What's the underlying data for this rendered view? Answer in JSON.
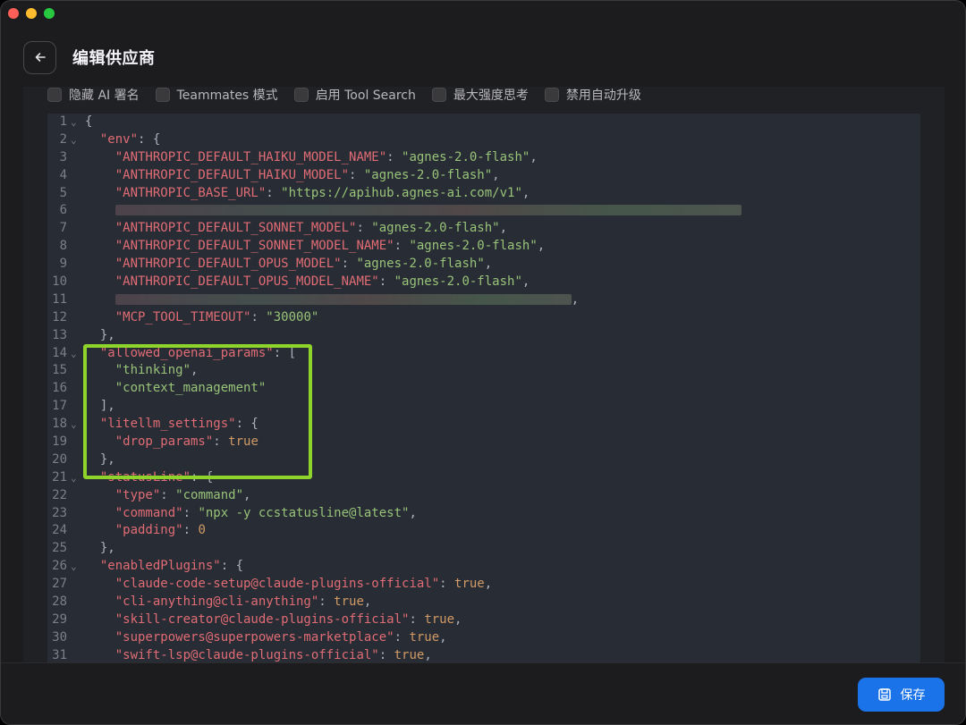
{
  "header": {
    "title": "编辑供应商"
  },
  "options": [
    {
      "label": "隐藏 AI 署名"
    },
    {
      "label": "Teammates 模式"
    },
    {
      "label": "启用 Tool Search"
    },
    {
      "label": "最大强度思考"
    },
    {
      "label": "禁用自动升级"
    }
  ],
  "footer": {
    "save_label": "保存"
  },
  "colors": {
    "accent": "#1a73e8",
    "highlight": "#8fd42b",
    "key": "#e06c75",
    "string": "#98c379"
  },
  "editor": {
    "lines": [
      {
        "n": "1",
        "fold": true,
        "tokens": [
          [
            "p",
            "{"
          ]
        ]
      },
      {
        "n": "2",
        "fold": true,
        "tokens": [
          [
            "p",
            "  "
          ],
          [
            "k",
            "\"env\""
          ],
          [
            "p",
            ": {"
          ]
        ]
      },
      {
        "n": "3",
        "tokens": [
          [
            "p",
            "    "
          ],
          [
            "k",
            "\"ANTHROPIC_DEFAULT_HAIKU_MODEL_NAME\""
          ],
          [
            "p",
            ": "
          ],
          [
            "s",
            "\"agnes-2.0-flash\""
          ],
          [
            "p",
            ","
          ]
        ]
      },
      {
        "n": "4",
        "tokens": [
          [
            "p",
            "    "
          ],
          [
            "k",
            "\"ANTHROPIC_DEFAULT_HAIKU_MODEL\""
          ],
          [
            "p",
            ": "
          ],
          [
            "s",
            "\"agnes-2.0-flash\""
          ],
          [
            "p",
            ","
          ]
        ]
      },
      {
        "n": "5",
        "tokens": [
          [
            "p",
            "    "
          ],
          [
            "k",
            "\"ANTHROPIC_BASE_URL\""
          ],
          [
            "p",
            ": "
          ],
          [
            "s",
            "\"https://apihub.agnes-ai.com/v1\""
          ],
          [
            "p",
            ","
          ]
        ]
      },
      {
        "n": "6",
        "tokens": [
          [
            "p",
            "    "
          ],
          [
            "blur",
            "700"
          ]
        ]
      },
      {
        "n": "7",
        "tokens": [
          [
            "p",
            "    "
          ],
          [
            "k",
            "\"ANTHROPIC_DEFAULT_SONNET_MODEL\""
          ],
          [
            "p",
            ": "
          ],
          [
            "s",
            "\"agnes-2.0-flash\""
          ],
          [
            "p",
            ","
          ]
        ]
      },
      {
        "n": "8",
        "tokens": [
          [
            "p",
            "    "
          ],
          [
            "k",
            "\"ANTHROPIC_DEFAULT_SONNET_MODEL_NAME\""
          ],
          [
            "p",
            ": "
          ],
          [
            "s",
            "\"agnes-2.0-flash\""
          ],
          [
            "p",
            ","
          ]
        ]
      },
      {
        "n": "9",
        "tokens": [
          [
            "p",
            "    "
          ],
          [
            "k",
            "\"ANTHROPIC_DEFAULT_OPUS_MODEL\""
          ],
          [
            "p",
            ": "
          ],
          [
            "s",
            "\"agnes-2.0-flash\""
          ],
          [
            "p",
            ","
          ]
        ]
      },
      {
        "n": "10",
        "tokens": [
          [
            "p",
            "    "
          ],
          [
            "k",
            "\"ANTHROPIC_DEFAULT_OPUS_MODEL_NAME\""
          ],
          [
            "p",
            ": "
          ],
          [
            "s",
            "\"agnes-2.0-flash\""
          ],
          [
            "p",
            ","
          ]
        ]
      },
      {
        "n": "11",
        "tokens": [
          [
            "p",
            "    "
          ],
          [
            "blur",
            "510"
          ],
          [
            "p",
            ","
          ]
        ]
      },
      {
        "n": "12",
        "tokens": [
          [
            "p",
            "    "
          ],
          [
            "k",
            "\"MCP_TOOL_TIMEOUT\""
          ],
          [
            "p",
            ": "
          ],
          [
            "s",
            "\"30000\""
          ]
        ]
      },
      {
        "n": "13",
        "tokens": [
          [
            "p",
            "  },"
          ]
        ]
      },
      {
        "n": "14",
        "fold": true,
        "tokens": [
          [
            "p",
            "  "
          ],
          [
            "k",
            "\"allowed_openai_params\""
          ],
          [
            "p",
            ": ["
          ]
        ]
      },
      {
        "n": "15",
        "tokens": [
          [
            "p",
            "    "
          ],
          [
            "s",
            "\"thinking\""
          ],
          [
            "p",
            ","
          ]
        ]
      },
      {
        "n": "16",
        "tokens": [
          [
            "p",
            "    "
          ],
          [
            "s",
            "\"context_management\""
          ]
        ]
      },
      {
        "n": "17",
        "tokens": [
          [
            "p",
            "  ],"
          ]
        ]
      },
      {
        "n": "18",
        "fold": true,
        "tokens": [
          [
            "p",
            "  "
          ],
          [
            "k",
            "\"litellm_settings\""
          ],
          [
            "p",
            ": {"
          ]
        ]
      },
      {
        "n": "19",
        "tokens": [
          [
            "p",
            "    "
          ],
          [
            "k",
            "\"drop_params\""
          ],
          [
            "p",
            ": "
          ],
          [
            "n",
            "true"
          ]
        ]
      },
      {
        "n": "20",
        "tokens": [
          [
            "p",
            "  },"
          ]
        ]
      },
      {
        "n": "21",
        "fold": true,
        "tokens": [
          [
            "p",
            "  "
          ],
          [
            "k",
            "\"statusLine\""
          ],
          [
            "p",
            ": {"
          ]
        ]
      },
      {
        "n": "22",
        "tokens": [
          [
            "p",
            "    "
          ],
          [
            "k",
            "\"type\""
          ],
          [
            "p",
            ": "
          ],
          [
            "s",
            "\"command\""
          ],
          [
            "p",
            ","
          ]
        ]
      },
      {
        "n": "23",
        "tokens": [
          [
            "p",
            "    "
          ],
          [
            "k",
            "\"command\""
          ],
          [
            "p",
            ": "
          ],
          [
            "s",
            "\"npx -y ccstatusline@latest\""
          ],
          [
            "p",
            ","
          ]
        ]
      },
      {
        "n": "24",
        "tokens": [
          [
            "p",
            "    "
          ],
          [
            "k",
            "\"padding\""
          ],
          [
            "p",
            ": "
          ],
          [
            "n",
            "0"
          ]
        ]
      },
      {
        "n": "25",
        "tokens": [
          [
            "p",
            "  },"
          ]
        ]
      },
      {
        "n": "26",
        "fold": true,
        "tokens": [
          [
            "p",
            "  "
          ],
          [
            "k",
            "\"enabledPlugins\""
          ],
          [
            "p",
            ": {"
          ]
        ]
      },
      {
        "n": "27",
        "tokens": [
          [
            "p",
            "    "
          ],
          [
            "k",
            "\"claude-code-setup@claude-plugins-official\""
          ],
          [
            "p",
            ": "
          ],
          [
            "n",
            "true"
          ],
          [
            "p",
            ","
          ]
        ]
      },
      {
        "n": "28",
        "tokens": [
          [
            "p",
            "    "
          ],
          [
            "k",
            "\"cli-anything@cli-anything\""
          ],
          [
            "p",
            ": "
          ],
          [
            "n",
            "true"
          ],
          [
            "p",
            ","
          ]
        ]
      },
      {
        "n": "29",
        "tokens": [
          [
            "p",
            "    "
          ],
          [
            "k",
            "\"skill-creator@claude-plugins-official\""
          ],
          [
            "p",
            ": "
          ],
          [
            "n",
            "true"
          ],
          [
            "p",
            ","
          ]
        ]
      },
      {
        "n": "30",
        "tokens": [
          [
            "p",
            "    "
          ],
          [
            "k",
            "\"superpowers@superpowers-marketplace\""
          ],
          [
            "p",
            ": "
          ],
          [
            "n",
            "true"
          ],
          [
            "p",
            ","
          ]
        ]
      },
      {
        "n": "31",
        "tokens": [
          [
            "p",
            "    "
          ],
          [
            "k",
            "\"swift-lsp@claude-plugins-official\""
          ],
          [
            "p",
            ": "
          ],
          [
            "n",
            "true"
          ],
          [
            "p",
            ","
          ]
        ]
      }
    ]
  }
}
